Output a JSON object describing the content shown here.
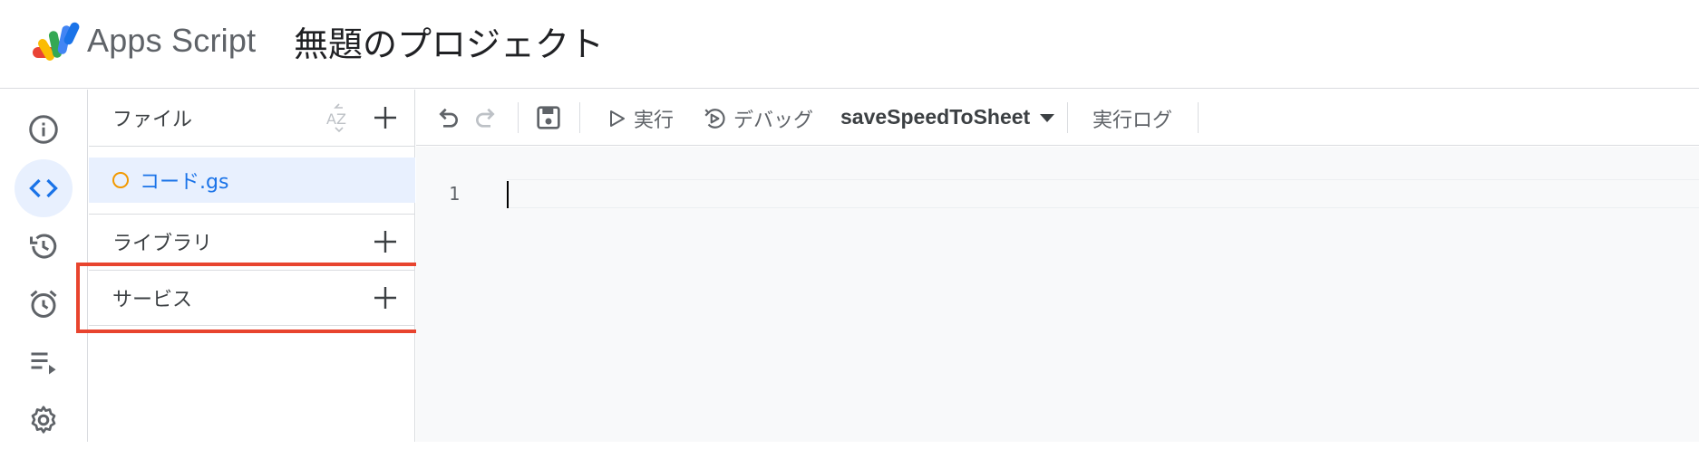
{
  "header": {
    "app_name": "Apps Script",
    "project_title": "無題のプロジェクト"
  },
  "rail": {
    "items": [
      {
        "icon": "info-icon",
        "active": false
      },
      {
        "icon": "code-icon",
        "active": true
      },
      {
        "icon": "history-icon",
        "active": false
      },
      {
        "icon": "alarm-icon",
        "active": false
      },
      {
        "icon": "executions-icon",
        "active": false
      },
      {
        "icon": "gear-icon",
        "active": false
      }
    ]
  },
  "files": {
    "section_label": "ファイル",
    "items": [
      {
        "name": "コード.gs"
      }
    ]
  },
  "libraries": {
    "section_label": "ライブラリ"
  },
  "services": {
    "section_label": "サービス"
  },
  "toolbar": {
    "run_label": "実行",
    "debug_label": "デバッグ",
    "function_name": "saveSpeedToSheet",
    "log_label": "実行ログ"
  },
  "editor": {
    "line_number": "1"
  },
  "colors": {
    "accent": "#1a73e8",
    "active_bg": "#e8f0fe",
    "highlight_border": "#e8442e",
    "file_dot": "#f29900"
  }
}
